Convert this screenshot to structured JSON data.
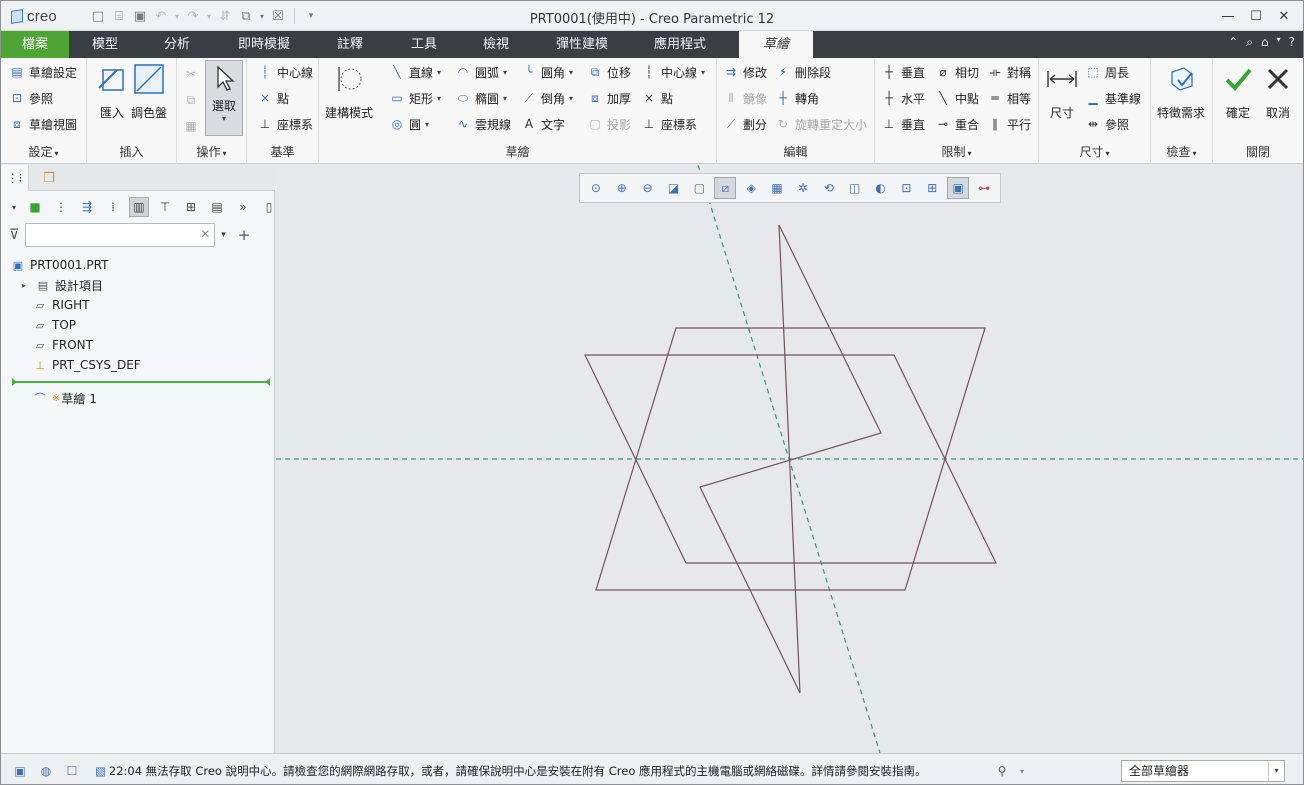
{
  "app": {
    "logo": "creo",
    "window_title": "PRT0001(使用中) - Creo Parametric 12"
  },
  "tabs": [
    {
      "label": "檔案"
    },
    {
      "label": "模型"
    },
    {
      "label": "分析"
    },
    {
      "label": "即時模擬"
    },
    {
      "label": "註釋"
    },
    {
      "label": "工具"
    },
    {
      "label": "檢視"
    },
    {
      "label": "彈性建模"
    },
    {
      "label": "應用程式"
    },
    {
      "label": "草繪"
    }
  ],
  "ribbon": {
    "setup": {
      "label": "設定",
      "items": [
        "草繪設定",
        "參照",
        "草繪視圖"
      ]
    },
    "insert": {
      "label": "插入",
      "items": [
        "匯入",
        "調色盤"
      ]
    },
    "operations": {
      "label": "操作",
      "select": "選取"
    },
    "datum": {
      "label": "基準",
      "items": [
        "中心線",
        "點",
        "座標系"
      ]
    },
    "sketching": {
      "label": "草繪",
      "construction": "建構模式",
      "col1": [
        "直線",
        "矩形",
        "圓"
      ],
      "col2": [
        "圓弧",
        "橢圓",
        "雲規線"
      ],
      "col3": [
        "圓角",
        "倒角",
        "文字"
      ],
      "col4": [
        "位移",
        "加厚",
        "投影"
      ],
      "col5": [
        "中心線",
        "點",
        "座標系"
      ]
    },
    "editing": {
      "label": "編輯",
      "col1": [
        "修改",
        "鏡像",
        "劃分"
      ],
      "col2": [
        "刪除段",
        "轉角",
        "旋轉重定大小"
      ]
    },
    "constrain": {
      "label": "限制",
      "col1": [
        "垂直",
        "水平",
        "垂直"
      ],
      "col2": [
        "相切",
        "中點",
        "重合"
      ],
      "col3": [
        "對稱",
        "相等",
        "平行"
      ]
    },
    "dimension": {
      "label": "尺寸",
      "big": "尺寸",
      "items": [
        "周長",
        "基準線",
        "參照"
      ]
    },
    "inspect": {
      "label": "檢查",
      "big": "特徵需求"
    },
    "close": {
      "label": "關閉",
      "ok": "確定",
      "cancel": "取消"
    }
  },
  "model_tree": {
    "search_placeholder": "",
    "root": "PRT0001.PRT",
    "items": [
      "設計項目",
      "RIGHT",
      "TOP",
      "FRONT",
      "PRT_CSYS_DEF"
    ],
    "after_insert": "草繪 1",
    "new_marker": "※"
  },
  "status": {
    "message": "22:04 無法存取 Creo 說明中心。請檢查您的網際網路存取，或者，請確保說明中心是安裝在附有 Creo 應用程式的主機電腦或網絡磁碟。詳情請參閱安裝指南。",
    "filter_value": "全部草繪器"
  },
  "colors": {
    "accent_green": "#4ea535",
    "tab_bar": "#3a3e44",
    "sketch_line": "#7a5058",
    "reference_line": "#2a9a8a",
    "icon_blue": "#2d6fb8"
  }
}
